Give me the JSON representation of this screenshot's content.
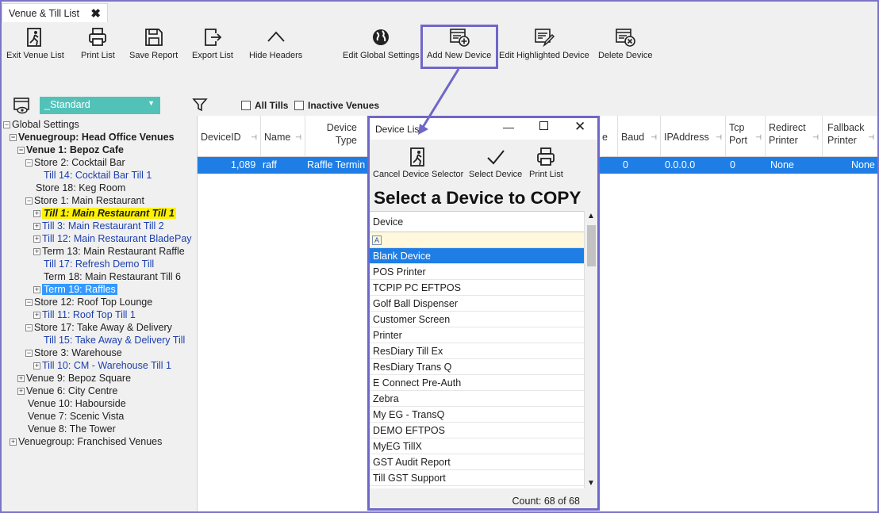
{
  "tab": {
    "title": "Venue & Till List",
    "close": "✖"
  },
  "toolbar": {
    "exit": "Exit Venue List",
    "print": "Print List",
    "save": "Save Report",
    "export": "Export List",
    "hide": "Hide Headers",
    "global": "Edit Global Settings",
    "add": "Add New Device",
    "edit": "Edit Highlighted Device",
    "delete": "Delete Device"
  },
  "filter": {
    "combo_value": "_Standard",
    "all_tills": "All Tills",
    "inactive_venues": "Inactive Venues"
  },
  "tree": {
    "global_settings": "Global Settings",
    "vg_head": "Venuegroup: Head Office Venues",
    "venue1": "Venue 1: Bepoz Cafe",
    "store2": "Store 2: Cocktail Bar",
    "till14": "Till 14: Cocktail Bar Till 1",
    "store18": "Store 18: Keg Room",
    "store1": "Store 1: Main Restaurant",
    "till1": "Till 1: Main Restaurant Till 1",
    "till3": "Till 3: Main Restaurant Till 2",
    "till12": "Till 12: Main Restaurant BladePay",
    "term13": "Term 13: Main Restaurant Raffle",
    "till17": "Till 17: Refresh Demo Till",
    "term18": "Term 18: Main Restaurant Till 6",
    "term19": "Term 19: Raffles",
    "store12": "Store 12: Roof Top Lounge",
    "till11": "Till 11: Roof Top Till 1",
    "store17": "Store 17: Take Away & Delivery",
    "till15": "Till 15: Take Away & Delivery Till",
    "store3": "Store 3: Warehouse",
    "till10": "Till 10: CM - Warehouse Till 1",
    "venue9": "Venue 9: Bepoz Square",
    "venue6": "Venue 6: City Centre",
    "venue10": "Venue 10: Habourside",
    "venue7": "Venue 7: Scenic Vista",
    "venue8": "Venue 8: The Tower",
    "vg_fran": "Venuegroup: Franchised Venues"
  },
  "grid": {
    "headers": {
      "device_id": "DeviceID",
      "name": "Name",
      "device_type_1": "Device",
      "device_type_2": "Type",
      "e": "e",
      "baud": "Baud",
      "ip": "IPAddress",
      "tcp_1": "Tcp",
      "tcp_2": "Port",
      "redirect_1": "Redirect",
      "redirect_2": "Printer",
      "fallback_1": "Fallback",
      "fallback_2": "Printer"
    },
    "row": {
      "device_id": "1,089",
      "name": "raff",
      "device_type": "Raffle Termin",
      "baud": "0",
      "ip": "0.0.0.0",
      "tcp": "0",
      "redirect": "None",
      "fallback": "None"
    }
  },
  "popup": {
    "title": "Device List",
    "cancel": "Cancel Device Selector",
    "select": "Select Device",
    "print": "Print List",
    "heading": "Select a Device to COPY",
    "column": "Device",
    "items": [
      "Blank Device",
      "POS Printer",
      "TCPIP PC EFTPOS",
      "Golf Ball Dispenser",
      "Customer Screen",
      "Printer",
      "ResDiary Till Ex",
      "ResDiary Trans Q",
      "E Connect Pre-Auth",
      "Zebra",
      "My EG - TransQ",
      "DEMO EFTPOS",
      "MyEG TillX",
      "GST Audit Report",
      "Till GST Support"
    ],
    "count": "Count: 68 of 68"
  },
  "colors": {
    "accent": "#6f67c8",
    "selection": "#1e7ee6",
    "combo": "#52c2b9",
    "tree_highlight": "#fff200"
  }
}
